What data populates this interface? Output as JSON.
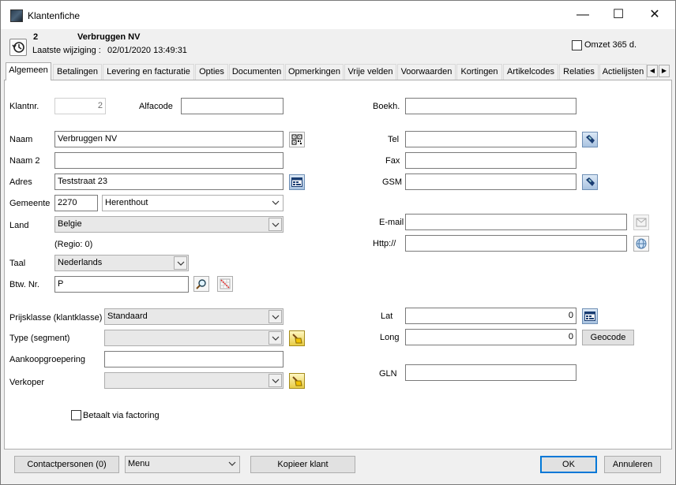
{
  "window": {
    "title": "Klantenfiche",
    "minimize": "—",
    "maximize": "☐",
    "close": "✕"
  },
  "header": {
    "number": "2",
    "name": "Verbruggen NV",
    "last_modified_label": "Laatste wijziging :",
    "last_modified_value": "02/01/2020 13:49:31",
    "omzet_label": "Omzet 365 d."
  },
  "tabs": [
    {
      "label": "Algemeen"
    },
    {
      "label": "Betalingen"
    },
    {
      "label": "Levering en facturatie"
    },
    {
      "label": "Opties"
    },
    {
      "label": "Documenten"
    },
    {
      "label": "Opmerkingen"
    },
    {
      "label": "Vrije velden"
    },
    {
      "label": "Voorwaarden"
    },
    {
      "label": "Kortingen"
    },
    {
      "label": "Artikelcodes"
    },
    {
      "label": "Relaties"
    },
    {
      "label": "Actielijsten"
    }
  ],
  "tab_scroll": {
    "left": "◀",
    "right": "▶"
  },
  "form": {
    "klantnr_label": "Klantnr.",
    "klantnr_value": "2",
    "alfacode_label": "Alfacode",
    "alfacode_value": "",
    "boekh_label": "Boekh.",
    "boekh_value": "",
    "naam_label": "Naam",
    "naam_value": "Verbruggen NV",
    "naam2_label": "Naam 2",
    "naam2_value": "",
    "adres_label": "Adres",
    "adres_value": "Teststraat 23",
    "gemeente_label": "Gemeente",
    "postcode_value": "2270",
    "gemeente_value": "Herenthout",
    "land_label": "Land",
    "land_value": "Belgie",
    "regio_text": "(Regio: 0)",
    "taal_label": "Taal",
    "taal_value": "Nederlands",
    "btw_label": "Btw. Nr.",
    "btw_value": "P",
    "tel_label": "Tel",
    "tel_value": "",
    "fax_label": "Fax",
    "fax_value": "",
    "gsm_label": "GSM",
    "gsm_value": "",
    "email_label": "E-mail",
    "email_value": "",
    "http_label": "Http://",
    "http_value": "",
    "prijsklasse_label": "Prijsklasse (klantklasse)",
    "prijsklasse_value": "Standaard",
    "type_label": "Type (segment)",
    "type_value": "",
    "aankoop_label": "Aankoopgroepering",
    "aankoop_value": "",
    "verkoper_label": "Verkoper",
    "verkoper_value": "",
    "lat_label": "Lat",
    "lat_value": "0",
    "long_label": "Long",
    "long_value": "0",
    "geocode_button": "Geocode",
    "gln_label": "GLN",
    "gln_value": "",
    "factoring_label": "Betaalt via factoring"
  },
  "footer": {
    "contactpersonen": "Contactpersonen (0)",
    "menu_value": "Menu",
    "kopieer": "Kopieer klant",
    "ok": "OK",
    "annuleren": "Annuleren"
  },
  "icons": {
    "qr": "qr-code-icon",
    "calendar": "address-card-icon",
    "phone": "phone-icon",
    "mail": "mail-icon",
    "globe": "globe-icon",
    "search": "search-icon",
    "grid": "vat-check-icon",
    "broom": "clear-icon",
    "history": "history-icon"
  }
}
